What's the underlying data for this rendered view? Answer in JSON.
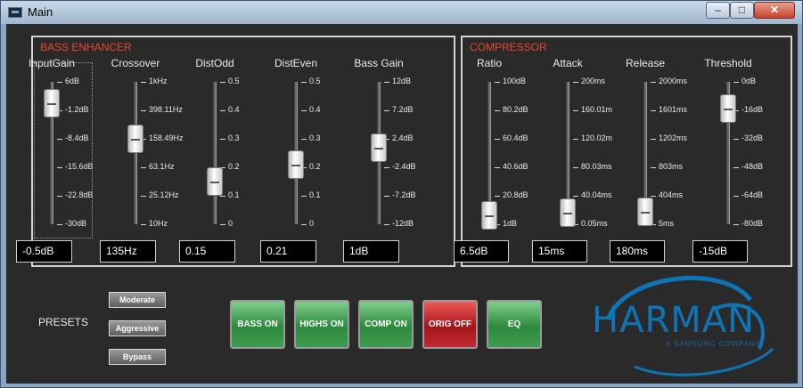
{
  "window": {
    "title": "Main",
    "min_glyph": "–",
    "max_glyph": "□",
    "close_glyph": "✕"
  },
  "bass": {
    "title": "BASS ENHANCER",
    "channels": [
      {
        "label": "InputGain",
        "ticks": [
          "6dB",
          "-1.2dB",
          "-8.4dB",
          "-15.6dB",
          "-22.8dB",
          "-30dB"
        ],
        "value": "-0.5dB",
        "level": 0.85
      },
      {
        "label": "Crossover",
        "ticks": [
          "1kHz",
          "398.11Hz",
          "158.49Hz",
          "63.1Hz",
          "25.12Hz",
          "10Hz"
        ],
        "value": "135Hz",
        "level": 0.6
      },
      {
        "label": "DistOdd",
        "ticks": [
          "0.5",
          "0.4",
          "0.3",
          "0.2",
          "0.1",
          "0"
        ],
        "value": "0.15",
        "level": 0.3
      },
      {
        "label": "DistEven",
        "ticks": [
          "0.5",
          "0.4",
          "0.3",
          "0.2",
          "0.1",
          "0"
        ],
        "value": "0.21",
        "level": 0.42
      },
      {
        "label": "Bass Gain",
        "ticks": [
          "12dB",
          "7.2dB",
          "2.4dB",
          "-2.4dB",
          "-7.2dB",
          "-12dB"
        ],
        "value": "1dB",
        "level": 0.54
      }
    ]
  },
  "comp": {
    "title": "COMPRESSOR",
    "channels": [
      {
        "label": "Ratio",
        "ticks": [
          "100dB",
          "80.2dB",
          "60.4dB",
          "40.6dB",
          "20.8dB",
          "1dB"
        ],
        "value": "6.5dB",
        "level": 0.06
      },
      {
        "label": "Attack",
        "ticks": [
          "200ms",
          "160.01m",
          "120.02m",
          "80.03ms",
          "40.04ms",
          "0.05ms"
        ],
        "value": "15ms",
        "level": 0.08
      },
      {
        "label": "Release",
        "ticks": [
          "2000ms",
          "1601ms",
          "1202ms",
          "803ms",
          "404ms",
          "5ms"
        ],
        "value": "180ms",
        "level": 0.09
      },
      {
        "label": "Threshold",
        "ticks": [
          "0dB",
          "-16dB",
          "-32dB",
          "-48dB",
          "-64dB",
          "-80dB"
        ],
        "value": "-15dB",
        "level": 0.81
      }
    ]
  },
  "presets": {
    "label": "PRESETS",
    "buttons": [
      "Moderate",
      "Aggressive",
      "Bypass"
    ]
  },
  "toggles": [
    {
      "label": "BASS ON",
      "color": "green"
    },
    {
      "label": "HIGHS ON",
      "color": "green"
    },
    {
      "label": "COMP ON",
      "color": "green"
    },
    {
      "label": "ORIG OFF",
      "color": "red"
    },
    {
      "label": "EQ",
      "color": "green"
    }
  ],
  "logo": {
    "text": "HARMAN",
    "tagline": "A SAMSUNG COMPANY",
    "color": "#0f74b5"
  }
}
